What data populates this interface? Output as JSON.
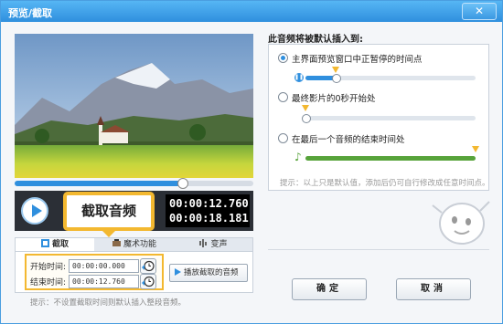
{
  "window": {
    "title": "预览/截取",
    "close_label": "✕"
  },
  "player": {
    "seek_progress": 0.7,
    "capture_label": "截取音频",
    "time_start": "00:00:12.760",
    "time_end": "00:00:18.181"
  },
  "tabs": [
    {
      "label": "截取",
      "active": true,
      "icon": "capture-icon"
    },
    {
      "label": "魔术功能",
      "active": false,
      "icon": "magic-icon"
    },
    {
      "label": "变声",
      "active": false,
      "icon": "voice-change-icon"
    }
  ],
  "capture": {
    "start_label": "开始时间:",
    "start_value": "00:00:00.000",
    "end_label": "结束时间:",
    "end_value": "00:00:12.760",
    "play_label": "播放截取的音频",
    "hint": "提示：不设置截取时间则默认插入整段音频。"
  },
  "insert": {
    "heading": "此音频将被默认插入到:",
    "options": [
      {
        "label": "主界面预览窗口中正暂停的时间点",
        "selected": true,
        "position": 0.18
      },
      {
        "label": "最终影片的0秒开始处",
        "selected": false,
        "position": 0.0
      },
      {
        "label": "在最后一个音频的结束时间处",
        "selected": false,
        "position": 1.0
      }
    ],
    "hint": "提示：以上只是默认值，添加后仍可自行修改成任意时间点。"
  },
  "buttons": {
    "ok": "确定",
    "cancel": "取消"
  },
  "colors": {
    "accent": "#2f8fde",
    "highlight": "#f3b830",
    "green": "#57a33a"
  }
}
